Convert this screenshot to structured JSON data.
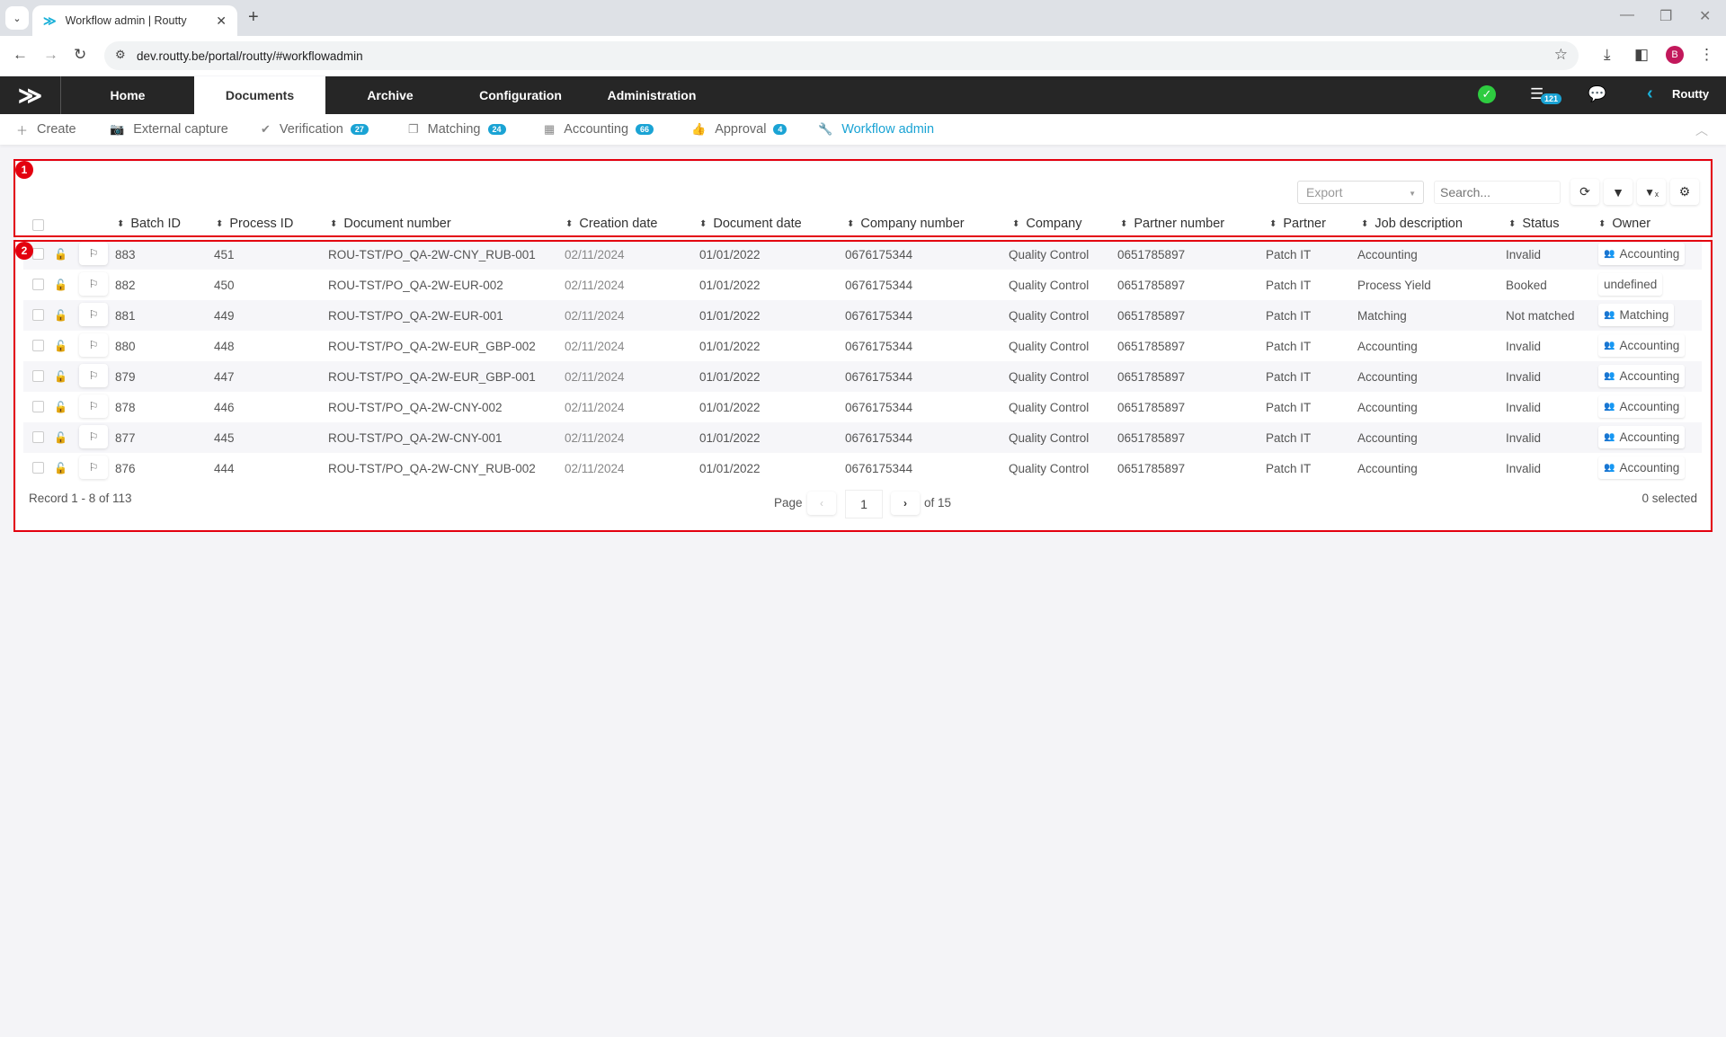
{
  "browser": {
    "tab_title": "Workflow admin | Routty",
    "url": "dev.routty.be/portal/routty/#workflowadmin",
    "profile_initial": "B"
  },
  "appbar": {
    "menu": [
      "Home",
      "Documents",
      "Archive",
      "Configuration",
      "Administration"
    ],
    "active_menu": "Documents",
    "task_count": "121",
    "user": "Routty"
  },
  "subnav": {
    "items": [
      {
        "label": "Create",
        "icon": "plus-icon"
      },
      {
        "label": "External capture",
        "icon": "camera-icon"
      },
      {
        "label": "Verification",
        "icon": "check-circle-icon",
        "badge": "27"
      },
      {
        "label": "Matching",
        "icon": "files-icon",
        "badge": "24"
      },
      {
        "label": "Accounting",
        "icon": "calculator-icon",
        "badge": "66"
      },
      {
        "label": "Approval",
        "icon": "thumbs-up-icon",
        "badge": "4"
      },
      {
        "label": "Workflow admin",
        "icon": "wrench-icon"
      }
    ],
    "active": "Workflow admin"
  },
  "toolbar": {
    "export_placeholder": "Export",
    "search_placeholder": "Search..."
  },
  "annotations": [
    "1",
    "2"
  ],
  "table": {
    "columns": [
      "Batch ID",
      "Process ID",
      "Document number",
      "Creation date",
      "Document date",
      "Company number",
      "Company",
      "Partner number",
      "Partner",
      "Job description",
      "Status",
      "Owner"
    ],
    "rows": [
      {
        "batch": "883",
        "process": "451",
        "docnum": "ROU-TST/PO_QA-2W-CNY_RUB-001",
        "created": "02/11/2024",
        "docdate": "01/01/2022",
        "compnum": "0676175344",
        "company": "Quality Control",
        "partnum": "0651785897",
        "partner": "Patch IT",
        "job": "Accounting",
        "status": "Invalid",
        "owner": "Accounting",
        "owner_group": true
      },
      {
        "batch": "882",
        "process": "450",
        "docnum": "ROU-TST/PO_QA-2W-EUR-002",
        "created": "02/11/2024",
        "docdate": "01/01/2022",
        "compnum": "0676175344",
        "company": "Quality Control",
        "partnum": "0651785897",
        "partner": "Patch IT",
        "job": "Process Yield",
        "status": "Booked",
        "owner": "undefined",
        "owner_group": false
      },
      {
        "batch": "881",
        "process": "449",
        "docnum": "ROU-TST/PO_QA-2W-EUR-001",
        "created": "02/11/2024",
        "docdate": "01/01/2022",
        "compnum": "0676175344",
        "company": "Quality Control",
        "partnum": "0651785897",
        "partner": "Patch IT",
        "job": "Matching",
        "status": "Not matched",
        "owner": "Matching",
        "owner_group": true
      },
      {
        "batch": "880",
        "process": "448",
        "docnum": "ROU-TST/PO_QA-2W-EUR_GBP-002",
        "created": "02/11/2024",
        "docdate": "01/01/2022",
        "compnum": "0676175344",
        "company": "Quality Control",
        "partnum": "0651785897",
        "partner": "Patch IT",
        "job": "Accounting",
        "status": "Invalid",
        "owner": "Accounting",
        "owner_group": true
      },
      {
        "batch": "879",
        "process": "447",
        "docnum": "ROU-TST/PO_QA-2W-EUR_GBP-001",
        "created": "02/11/2024",
        "docdate": "01/01/2022",
        "compnum": "0676175344",
        "company": "Quality Control",
        "partnum": "0651785897",
        "partner": "Patch IT",
        "job": "Accounting",
        "status": "Invalid",
        "owner": "Accounting",
        "owner_group": true
      },
      {
        "batch": "878",
        "process": "446",
        "docnum": "ROU-TST/PO_QA-2W-CNY-002",
        "created": "02/11/2024",
        "docdate": "01/01/2022",
        "compnum": "0676175344",
        "company": "Quality Control",
        "partnum": "0651785897",
        "partner": "Patch IT",
        "job": "Accounting",
        "status": "Invalid",
        "owner": "Accounting",
        "owner_group": true
      },
      {
        "batch": "877",
        "process": "445",
        "docnum": "ROU-TST/PO_QA-2W-CNY-001",
        "created": "02/11/2024",
        "docdate": "01/01/2022",
        "compnum": "0676175344",
        "company": "Quality Control",
        "partnum": "0651785897",
        "partner": "Patch IT",
        "job": "Accounting",
        "status": "Invalid",
        "owner": "Accounting",
        "owner_group": true
      },
      {
        "batch": "876",
        "process": "444",
        "docnum": "ROU-TST/PO_QA-2W-CNY_RUB-002",
        "created": "02/11/2024",
        "docdate": "01/01/2022",
        "compnum": "0676175344",
        "company": "Quality Control",
        "partnum": "0651785897",
        "partner": "Patch IT",
        "job": "Accounting",
        "status": "Invalid",
        "owner": "Accounting",
        "owner_group": true
      }
    ]
  },
  "footer": {
    "records": "Record 1 - 8 of 113",
    "page_label": "Page",
    "page": "1",
    "of_pages": "of 15",
    "selected": "0 selected"
  }
}
